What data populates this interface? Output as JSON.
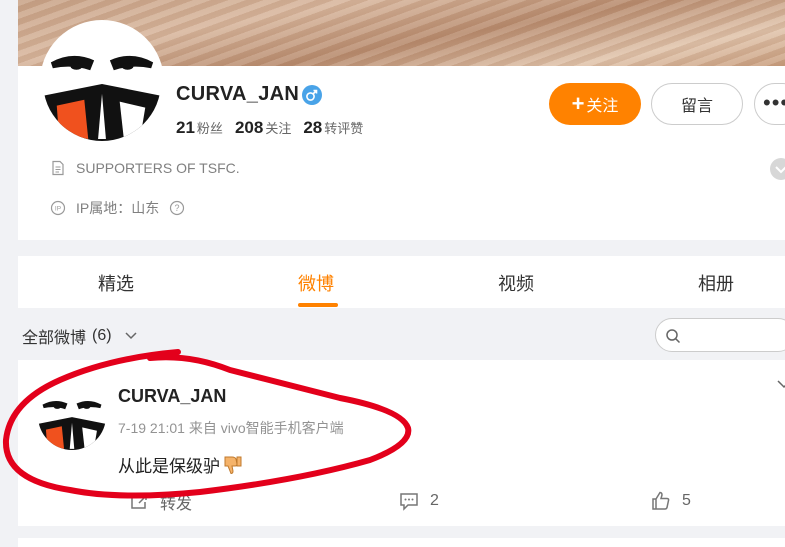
{
  "profile": {
    "username": "CURVA_JAN",
    "gender": "male",
    "stats": [
      {
        "value": "21",
        "label": "粉丝"
      },
      {
        "value": "208",
        "label": "关注"
      },
      {
        "value": "28",
        "label": "转评赞"
      }
    ],
    "follow_label": "关注",
    "message_label": "留言",
    "more_label": "•••",
    "description": "SUPPORTERS OF TSFC.",
    "ip_location": "IP属地：山东"
  },
  "tabs": [
    {
      "label": "精选",
      "active": false
    },
    {
      "label": "微博",
      "active": true
    },
    {
      "label": "视频",
      "active": false
    },
    {
      "label": "相册",
      "active": false
    }
  ],
  "filter": {
    "label": "全部微博",
    "count": "(6)"
  },
  "search": {
    "placeholder": ""
  },
  "post": {
    "author": "CURVA_JAN",
    "meta": "7-19 21:01  来自 vivo智能手机客户端",
    "text": "从此是保级驴",
    "repost_label": "转发",
    "comment_count": "2",
    "like_count": "5"
  },
  "colors": {
    "accent": "#ff8200",
    "annotation": "#e3001b",
    "gender_icon": "#49a3e8"
  }
}
